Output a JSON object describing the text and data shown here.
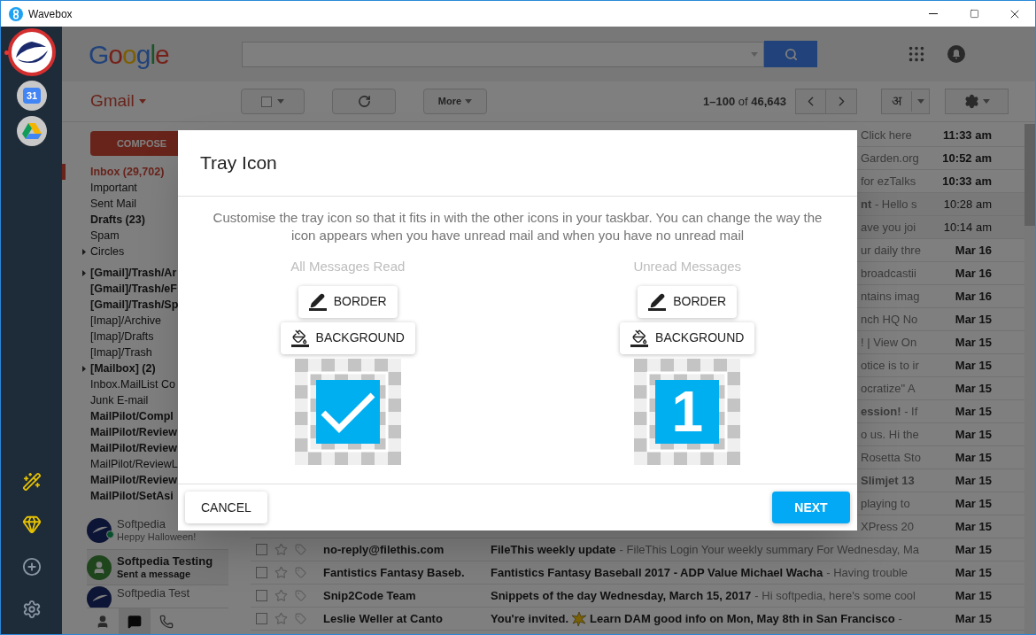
{
  "window": {
    "title": "Wavebox"
  },
  "services": [
    {
      "kind": "account"
    },
    {
      "kind": "calendar",
      "text": "31"
    },
    {
      "kind": "drive"
    }
  ],
  "sidebar_tools": [
    {
      "kind": "wand"
    },
    {
      "kind": "gem"
    },
    {
      "kind": "add"
    },
    {
      "kind": "settings"
    }
  ],
  "google": {
    "logo": "Google"
  },
  "toolbar": {
    "app_menu": "Gmail",
    "more": "More",
    "range": "**1–100** of **46,643**",
    "input_tool": "अ"
  },
  "compose": "COMPOSE",
  "folder_sections": [
    {
      "items": [
        {
          "label": "Inbox (29,702)",
          "selected": true,
          "unread": true,
          "expandable": false
        },
        {
          "label": "Important",
          "selected": false,
          "unread": false,
          "expandable": false
        },
        {
          "label": "Sent Mail",
          "selected": false,
          "unread": false,
          "expandable": false
        },
        {
          "label": "Drafts (23)",
          "selected": false,
          "unread": true,
          "expandable": false
        },
        {
          "label": "Spam",
          "selected": false,
          "unread": false,
          "expandable": false
        },
        {
          "label": "Circles",
          "selected": false,
          "unread": false,
          "expandable": true
        }
      ]
    },
    {
      "items": [
        {
          "label": "[Gmail]/Trash/Ar",
          "selected": false,
          "unread": true,
          "expandable": true
        },
        {
          "label": "[Gmail]/Trash/eF",
          "selected": false,
          "unread": true,
          "expandable": false
        },
        {
          "label": "[Gmail]/Trash/Sp",
          "selected": false,
          "unread": true,
          "expandable": false
        },
        {
          "label": "[Imap]/Archive",
          "selected": false,
          "unread": false,
          "expandable": false
        },
        {
          "label": "[Imap]/Drafts",
          "selected": false,
          "unread": false,
          "expandable": false
        },
        {
          "label": "[Imap]/Trash",
          "selected": false,
          "unread": false,
          "expandable": false
        },
        {
          "label": "[Mailbox] (2)",
          "selected": false,
          "unread": true,
          "expandable": true
        },
        {
          "label": "Inbox.MailList Co",
          "selected": false,
          "unread": false,
          "expandable": false
        },
        {
          "label": "Junk E-mail",
          "selected": false,
          "unread": false,
          "expandable": false
        },
        {
          "label": "MailPilot/Compl",
          "selected": false,
          "unread": true,
          "expandable": false
        },
        {
          "label": "MailPilot/Review",
          "selected": false,
          "unread": true,
          "expandable": false
        },
        {
          "label": "MailPilot/Review",
          "selected": false,
          "unread": true,
          "expandable": false
        },
        {
          "label": "MailPilot/ReviewL",
          "selected": false,
          "unread": false,
          "expandable": false
        },
        {
          "label": "MailPilot/Review",
          "selected": false,
          "unread": true,
          "expandable": false
        },
        {
          "label": "MailPilot/SetAsi",
          "selected": false,
          "unread": true,
          "expandable": false
        }
      ]
    }
  ],
  "hangouts": [
    {
      "name": "Softpedia",
      "message": "Heppy Halloween!",
      "kind": "logo",
      "online": true,
      "unread": false
    },
    {
      "name": "Softpedia Testing",
      "message": "Sent a message",
      "kind": "chat",
      "online": false,
      "unread": true
    },
    {
      "name": "Softpedia Test",
      "kind": "logo",
      "online": false,
      "unread": false
    }
  ],
  "hangout_tabs": [
    {
      "kind": "contacts",
      "selected": false
    },
    {
      "kind": "chat",
      "selected": true
    },
    {
      "kind": "phone",
      "selected": false
    }
  ],
  "emails": [
    {
      "kind": "covered",
      "text": "Click here",
      "date": "11:33 am",
      "unread": true
    },
    {
      "kind": "covered",
      "text": "Garden.org",
      "date": "10:52 am",
      "unread": true
    },
    {
      "kind": "covered",
      "text": "for ezTalks",
      "date": "10:33 am",
      "unread": true
    },
    {
      "kind": "covered",
      "text": "**nt** - Hello s",
      "date": "10:28 am",
      "unread": false
    },
    {
      "kind": "covered",
      "text": "ave you joi",
      "date": "10:14 am",
      "unread": false
    },
    {
      "kind": "covered",
      "text": "ur daily thre",
      "date": "Mar 16",
      "unread": true
    },
    {
      "kind": "covered",
      "text": "broadcastii",
      "date": "Mar 16",
      "unread": true
    },
    {
      "kind": "covered",
      "text": "ntains imag",
      "date": "Mar 16",
      "unread": true
    },
    {
      "kind": "covered",
      "text": "nch HQ No",
      "date": "Mar 15",
      "unread": true
    },
    {
      "kind": "covered",
      "text": "! | View On",
      "date": "Mar 15",
      "unread": true
    },
    {
      "kind": "covered",
      "text": "otice is to ir",
      "date": "Mar 15",
      "unread": true
    },
    {
      "kind": "covered",
      "text": "ocratize\" A",
      "date": "Mar 15",
      "unread": true
    },
    {
      "kind": "covered",
      "text": "**ession!** - If",
      "date": "Mar 15",
      "unread": true
    },
    {
      "kind": "covered",
      "text": "o us. Hi the",
      "date": "Mar 15",
      "unread": true
    },
    {
      "kind": "covered",
      "text": "Rosetta Sto",
      "date": "Mar 15",
      "unread": true
    },
    {
      "kind": "covered",
      "text": "**Slimjet 13**",
      "date": "Mar 15",
      "unread": true
    },
    {
      "kind": "covered",
      "text": "playing to",
      "date": "Mar 15",
      "unread": true
    },
    {
      "kind": "covered",
      "text": "XPress 20",
      "date": "Mar 15",
      "unread": true
    },
    {
      "kind": "full",
      "sender": "no-reply@filethis.com",
      "subject": "FileThis weekly update",
      "snippet": "- FileThis Login Your weekly summary For Wednesday, Ma",
      "date": "Mar 15",
      "unread": true,
      "starred": false,
      "selected": false
    },
    {
      "kind": "full",
      "sender": "Fantistics Fantasy Baseb.",
      "subject": "Fantistics Fantasy Baseball 2017 - ADP Value Michael Wacha",
      "snippet": "- Having trouble",
      "date": "Mar 15",
      "unread": true,
      "starred": false,
      "selected": false
    },
    {
      "kind": "full",
      "sender": "Snip2Code Team",
      "subject": "Snippets of the day Wednesday, March 15, 2017",
      "snippet": "- Hi softpedia, here's some cool",
      "date": "Mar 15",
      "unread": true,
      "starred": false,
      "selected": false
    },
    {
      "kind": "full",
      "sender": "Leslie Weller at Canto",
      "subject": "You're invited.",
      "subject_rest": "Learn DAM good info on Mon, May 8th in San Francisco",
      "snippet": "-",
      "date": "Mar 15",
      "unread": true,
      "starred": false,
      "selected": false
    }
  ],
  "dialog": {
    "title": "Tray Icon",
    "description": "Customise the tray icon so that it fits in with the other icons in your taskbar. You can change the way the icon appears when you have unread mail and when you have no unread mail",
    "columns": [
      {
        "heading": "All Messages Read",
        "buttons": [
          {
            "kind": "border",
            "label": "BORDER"
          },
          {
            "kind": "background",
            "label": "BACKGROUND"
          }
        ],
        "preview": {
          "kind": "check"
        }
      },
      {
        "heading": "Unread Messages",
        "buttons": [
          {
            "kind": "border",
            "label": "BORDER"
          },
          {
            "kind": "background",
            "label": "BACKGROUND"
          }
        ],
        "preview": {
          "kind": "count",
          "text": "1"
        }
      }
    ],
    "cancel": "CANCEL",
    "next": "NEXT"
  }
}
